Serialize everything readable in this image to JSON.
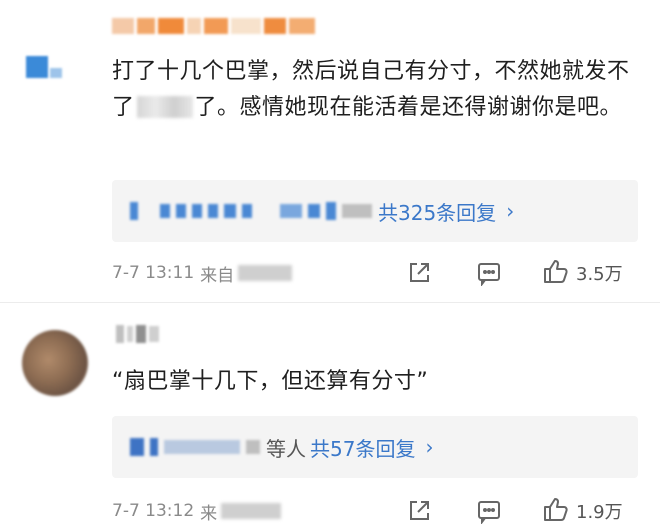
{
  "comments": [
    {
      "text_a": "打了十几个巴掌，然后说自己有分寸，不然她就发不了",
      "text_b": "了。感情她现在能活着是还得谢谢你是吧。",
      "reply_summary": "共325条回复",
      "reply_chevron": "›",
      "time": "7-7 13:11",
      "source_prefix": "来自",
      "likes": "3.5万"
    },
    {
      "text": "“扇巴掌十几下，但还算有分寸”",
      "reply_suffix": "等人",
      "reply_summary": "共57条回复",
      "reply_chevron": "›",
      "time": "7-7 13:12",
      "source_prefix": "来",
      "likes": "1.9万"
    }
  ],
  "colors": {
    "link": "#3b78c9",
    "meta": "#8a8a8a",
    "reply_bg": "#f4f4f4"
  },
  "icons": [
    "share-icon",
    "comment-icon",
    "like-icon"
  ]
}
